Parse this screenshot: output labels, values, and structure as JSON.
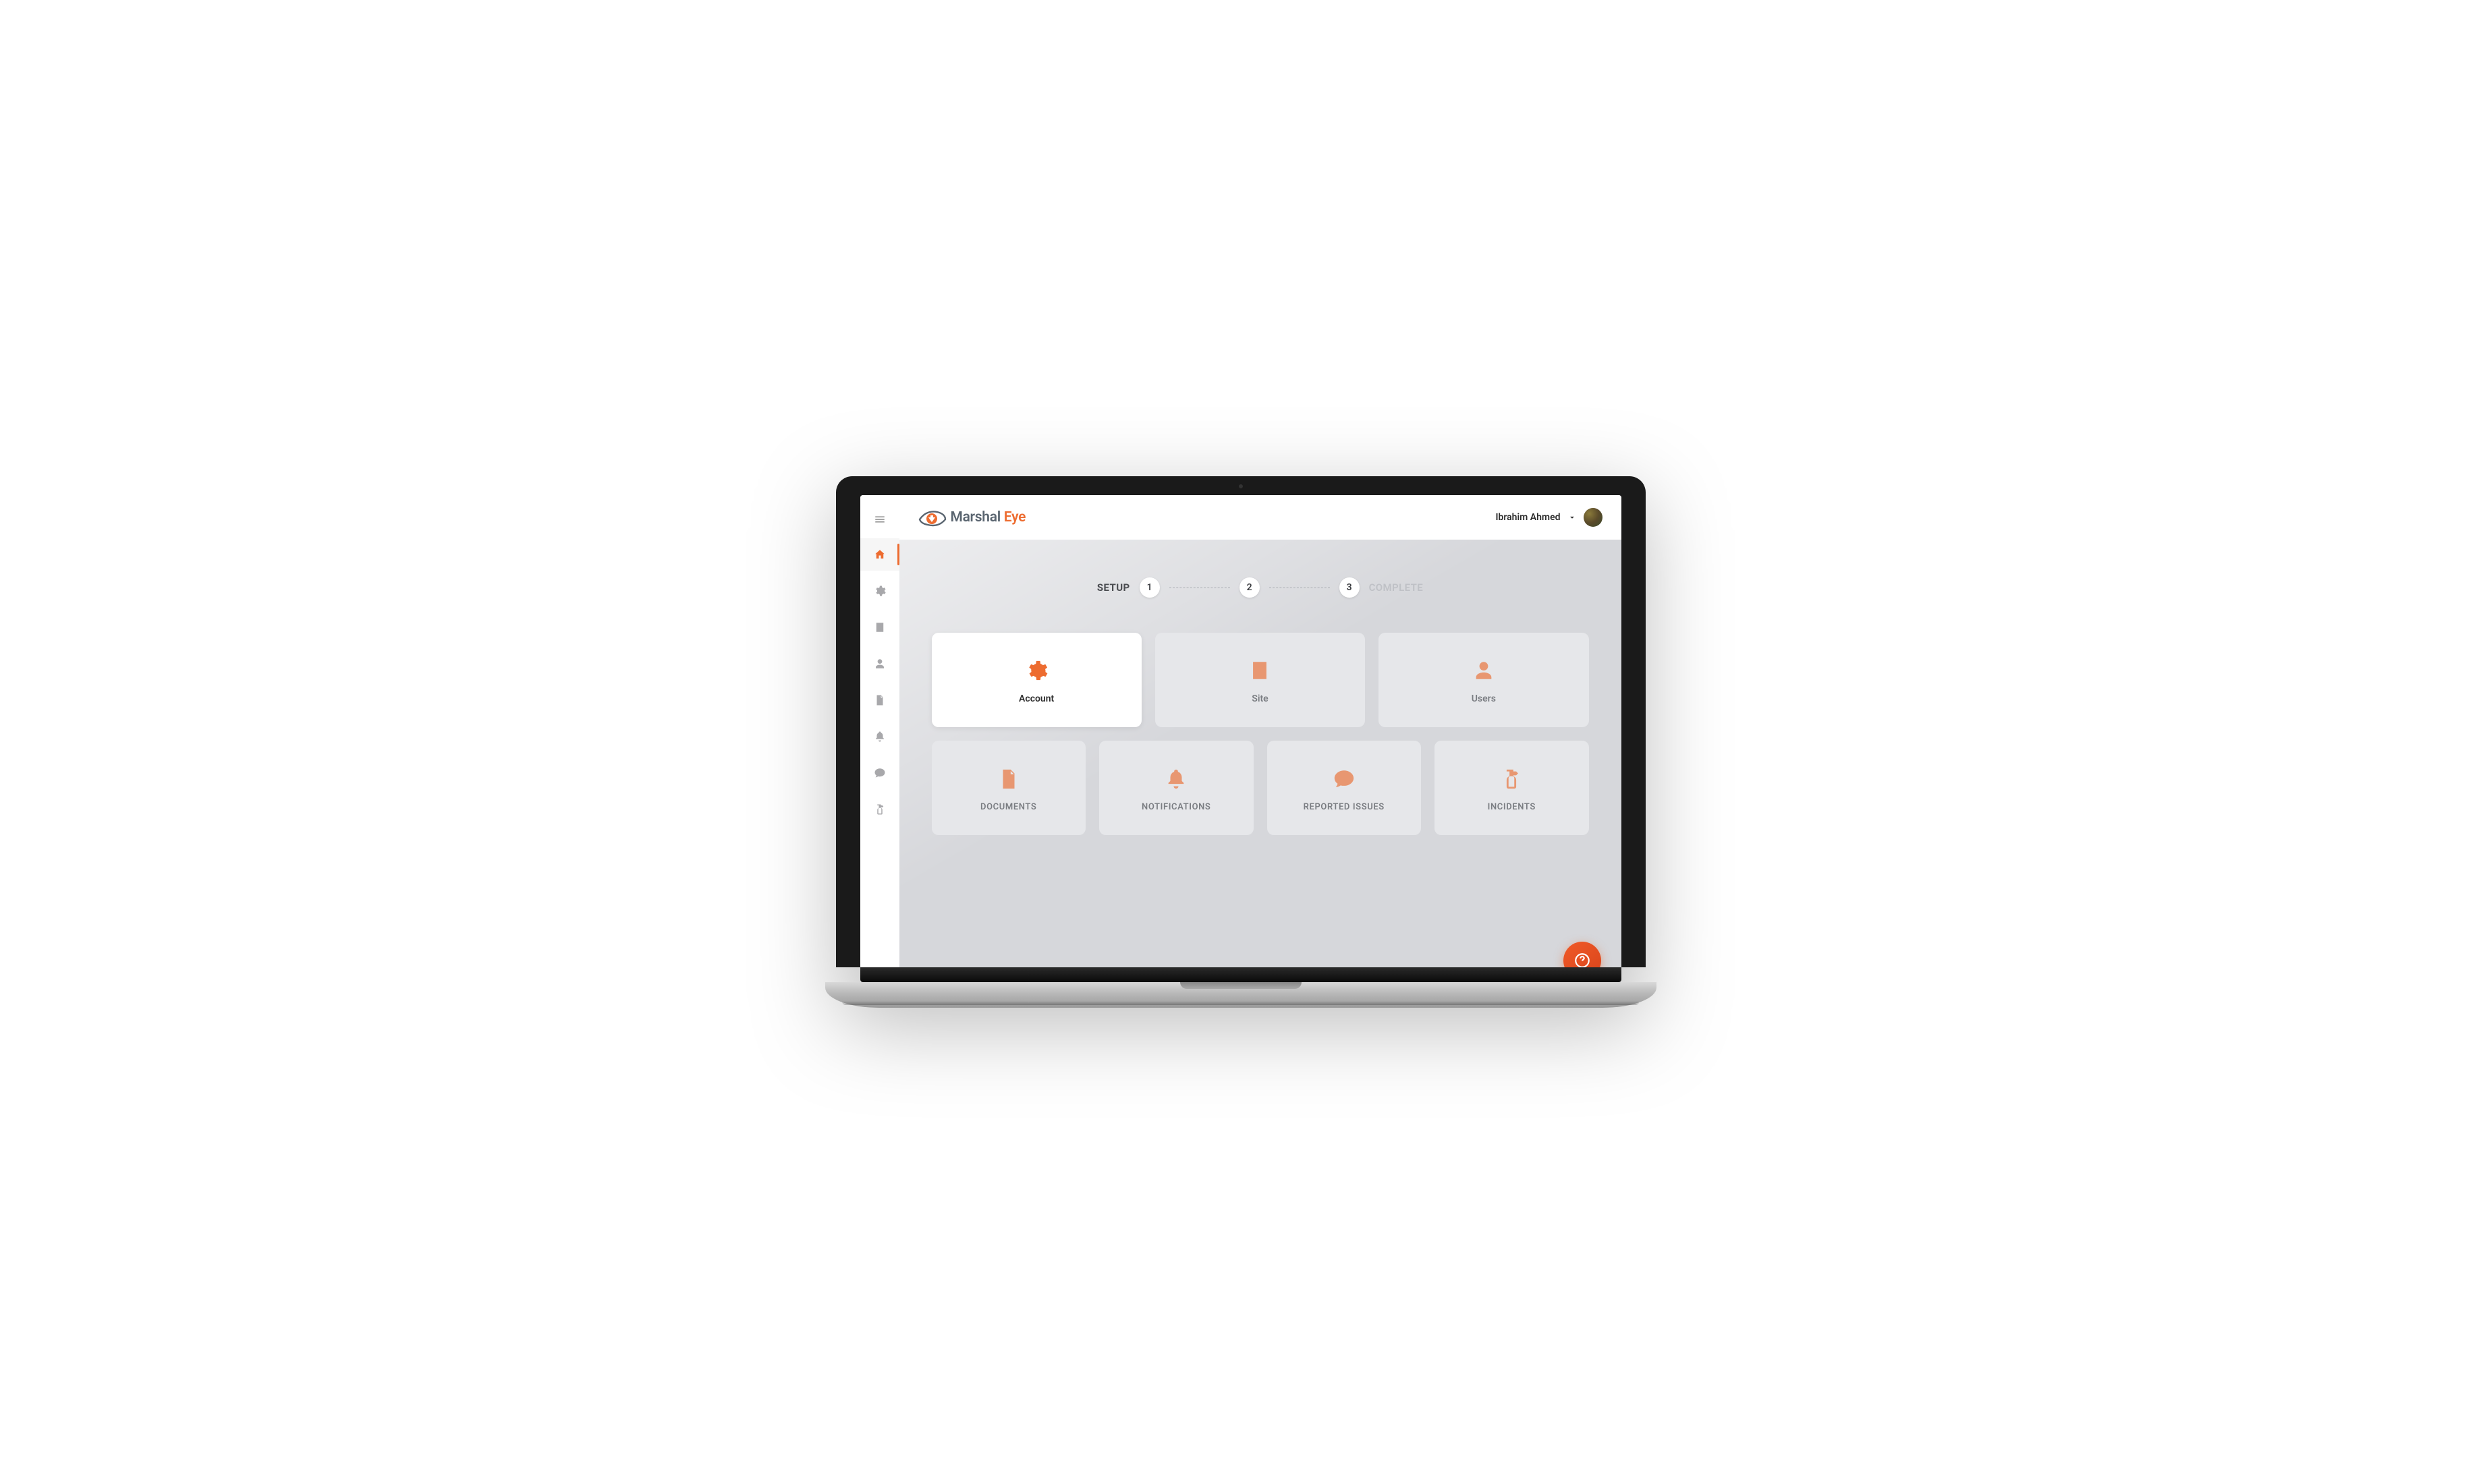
{
  "brand": {
    "name_part1": "Marshal",
    "name_part2": "Eye"
  },
  "header": {
    "user_name": "Ibrahim Ahmed"
  },
  "stepper": {
    "start_label": "SETUP",
    "end_label": "COMPLETE",
    "steps": [
      "1",
      "2",
      "3"
    ]
  },
  "primary_cards": [
    {
      "label": "Account",
      "icon": "gear",
      "active": true
    },
    {
      "label": "Site",
      "icon": "building",
      "active": false
    },
    {
      "label": "Users",
      "icon": "user",
      "active": false
    }
  ],
  "secondary_cards": [
    {
      "label": "DOCUMENTS",
      "icon": "document"
    },
    {
      "label": "NOTIFICATIONS",
      "icon": "bell"
    },
    {
      "label": "REPORTED ISSUES",
      "icon": "chat"
    },
    {
      "label": "INCIDENTS",
      "icon": "extinguisher"
    }
  ],
  "sidebar": {
    "items": [
      {
        "icon": "home",
        "active": true
      },
      {
        "icon": "gear",
        "active": false
      },
      {
        "icon": "building",
        "active": false
      },
      {
        "icon": "user",
        "active": false
      },
      {
        "icon": "document",
        "active": false
      },
      {
        "icon": "bell",
        "active": false
      },
      {
        "icon": "chat",
        "active": false
      },
      {
        "icon": "extinguisher",
        "active": false
      }
    ]
  },
  "colors": {
    "accent": "#ed6c30",
    "content_bg": "#d6d7db",
    "card_bg": "#e6e7ea",
    "text_primary": "#2d2d2d",
    "text_muted": "#7a7d82"
  }
}
